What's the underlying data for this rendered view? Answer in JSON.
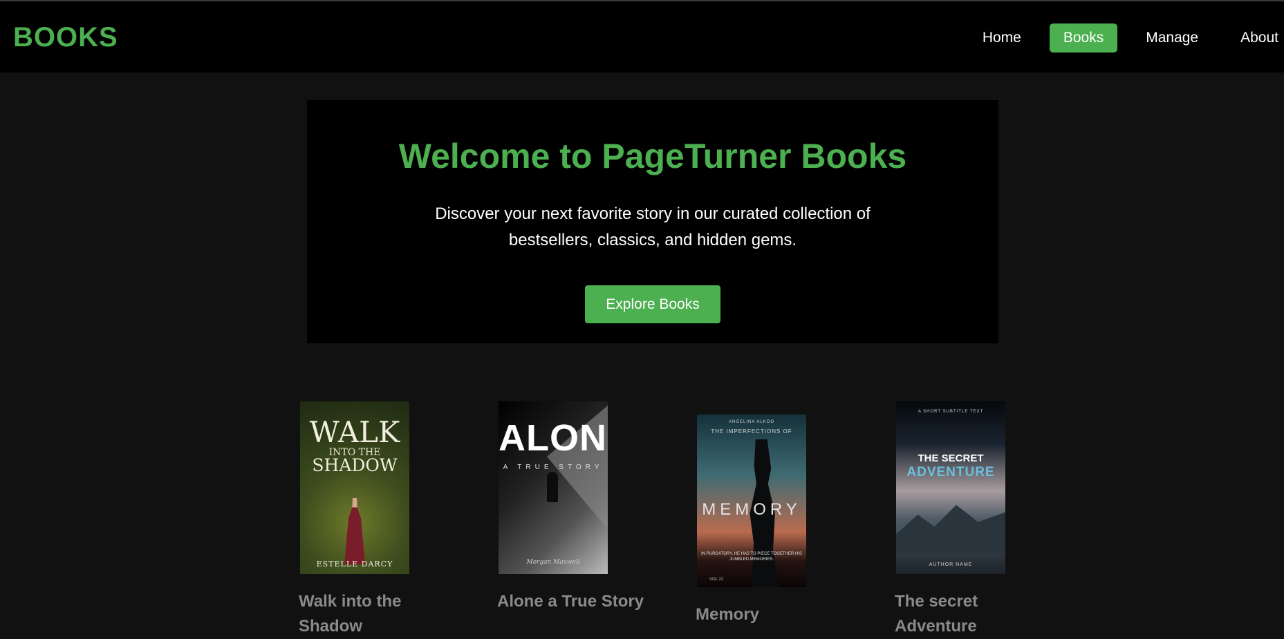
{
  "header": {
    "brand": "BOOKS",
    "nav": [
      {
        "label": "Home",
        "active": false
      },
      {
        "label": "Books",
        "active": true
      },
      {
        "label": "Manage",
        "active": false
      },
      {
        "label": "About",
        "active": false
      }
    ]
  },
  "hero": {
    "title": "Welcome to PageTurner Books",
    "subtitle": "Discover your next favorite story in our curated collection of bestsellers, classics, and hidden gems.",
    "cta": "Explore Books"
  },
  "books": [
    {
      "title": "Walk into the Shadow",
      "cover": {
        "line1": "WALK",
        "line2": "INTO THE",
        "line3": "SHADOW",
        "author": "ESTELLE DARCY"
      }
    },
    {
      "title": "Alone a True Story",
      "cover": {
        "line1": "ALONE",
        "line2": "A TRUE STORY",
        "signature": "Morgan Maxwell"
      }
    },
    {
      "title": "Memory",
      "cover": {
        "author": "ANGELINA ALKOO",
        "subtitle": "THE IMPERFECTIONS OF",
        "line1": "MEMORY",
        "blurb": "IN PURGATORY, HE HAS TO PIECE TOGETHER HIS JUMBLED MEMORIES.",
        "volume": "VOL 22"
      }
    },
    {
      "title": "The secret Adventure",
      "cover": {
        "tag": "A SHORT SUBTITLE TEXT",
        "line1": "THE SECRET",
        "line2": "ADVENTURE",
        "author": "AUTHOR NAME"
      }
    }
  ],
  "colors": {
    "accent": "#4caf50",
    "background": "#111111",
    "panel": "#000000",
    "book_title": "#8a8a8a"
  }
}
